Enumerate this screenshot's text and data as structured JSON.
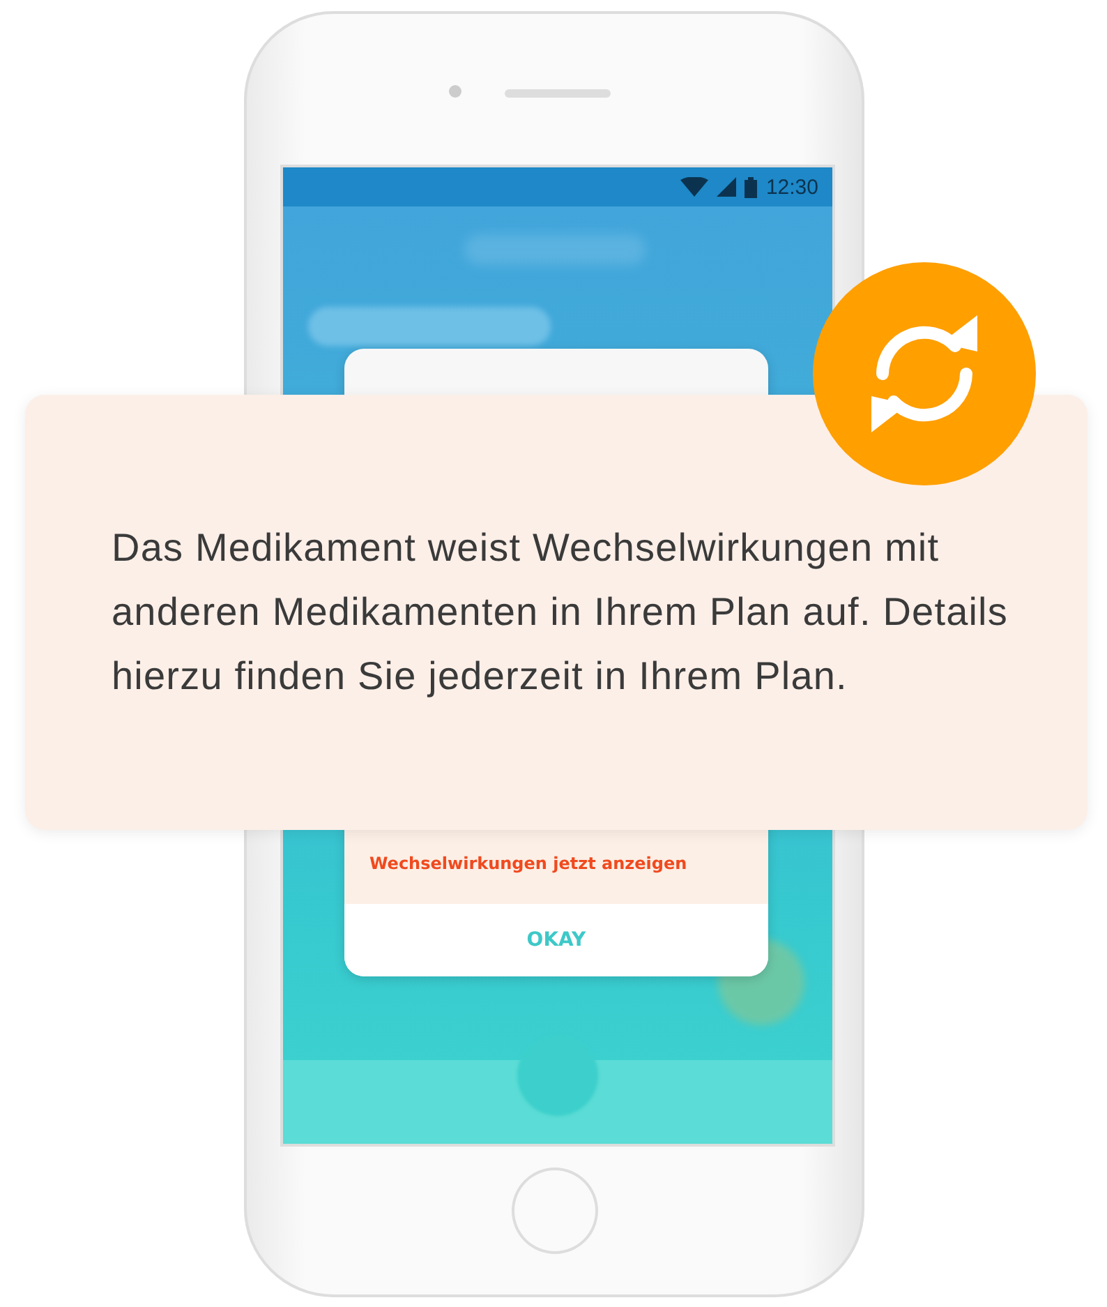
{
  "status_bar": {
    "time": "12:30"
  },
  "dialog": {
    "link": "Wechselwirkungen jetzt anzeigen",
    "button": "OKAY"
  },
  "callout": {
    "text": "Das Medikament weist Wechselwirkungen mit anderen Medikamenten in Ihrem Plan auf. Details hierzu finden Sie jederzeit in Ihrem Plan."
  }
}
